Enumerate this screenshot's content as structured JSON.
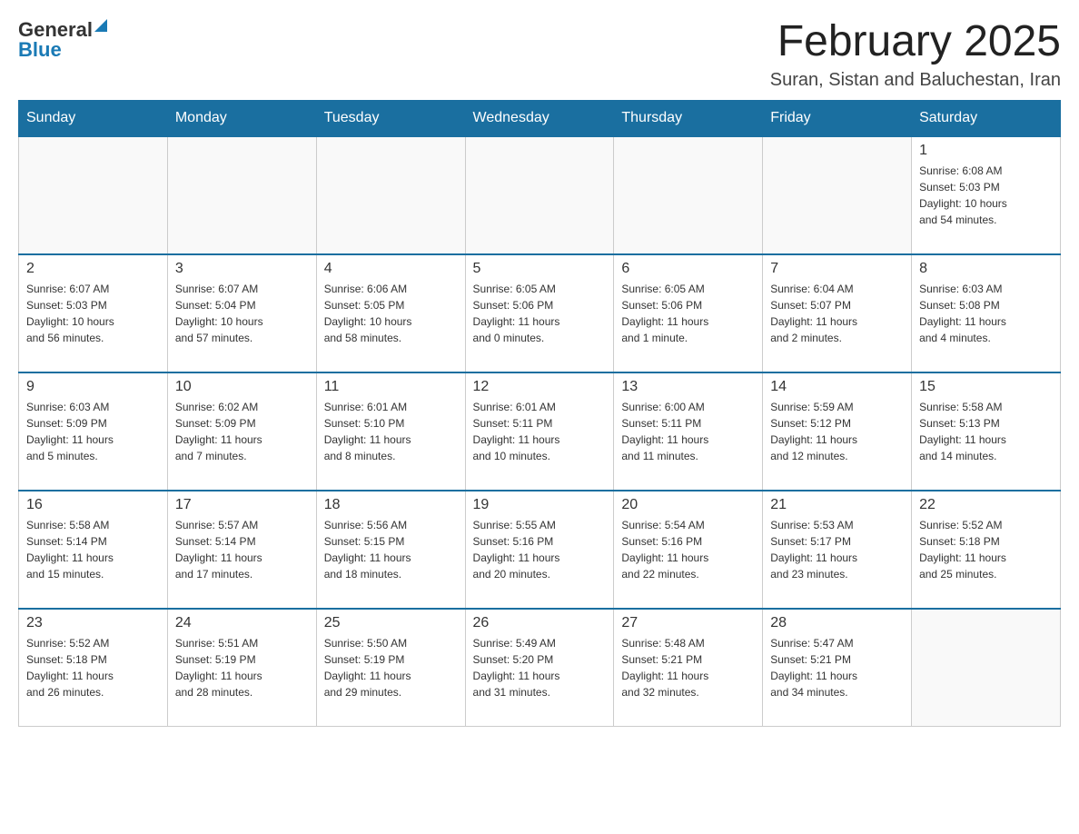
{
  "logo": {
    "general": "General",
    "blue": "Blue",
    "triangle": "▶"
  },
  "header": {
    "month_year": "February 2025",
    "location": "Suran, Sistan and Baluchestan, Iran"
  },
  "days_of_week": [
    "Sunday",
    "Monday",
    "Tuesday",
    "Wednesday",
    "Thursday",
    "Friday",
    "Saturday"
  ],
  "weeks": [
    [
      {
        "day": "",
        "info": ""
      },
      {
        "day": "",
        "info": ""
      },
      {
        "day": "",
        "info": ""
      },
      {
        "day": "",
        "info": ""
      },
      {
        "day": "",
        "info": ""
      },
      {
        "day": "",
        "info": ""
      },
      {
        "day": "1",
        "info": "Sunrise: 6:08 AM\nSunset: 5:03 PM\nDaylight: 10 hours\nand 54 minutes."
      }
    ],
    [
      {
        "day": "2",
        "info": "Sunrise: 6:07 AM\nSunset: 5:03 PM\nDaylight: 10 hours\nand 56 minutes."
      },
      {
        "day": "3",
        "info": "Sunrise: 6:07 AM\nSunset: 5:04 PM\nDaylight: 10 hours\nand 57 minutes."
      },
      {
        "day": "4",
        "info": "Sunrise: 6:06 AM\nSunset: 5:05 PM\nDaylight: 10 hours\nand 58 minutes."
      },
      {
        "day": "5",
        "info": "Sunrise: 6:05 AM\nSunset: 5:06 PM\nDaylight: 11 hours\nand 0 minutes."
      },
      {
        "day": "6",
        "info": "Sunrise: 6:05 AM\nSunset: 5:06 PM\nDaylight: 11 hours\nand 1 minute."
      },
      {
        "day": "7",
        "info": "Sunrise: 6:04 AM\nSunset: 5:07 PM\nDaylight: 11 hours\nand 2 minutes."
      },
      {
        "day": "8",
        "info": "Sunrise: 6:03 AM\nSunset: 5:08 PM\nDaylight: 11 hours\nand 4 minutes."
      }
    ],
    [
      {
        "day": "9",
        "info": "Sunrise: 6:03 AM\nSunset: 5:09 PM\nDaylight: 11 hours\nand 5 minutes."
      },
      {
        "day": "10",
        "info": "Sunrise: 6:02 AM\nSunset: 5:09 PM\nDaylight: 11 hours\nand 7 minutes."
      },
      {
        "day": "11",
        "info": "Sunrise: 6:01 AM\nSunset: 5:10 PM\nDaylight: 11 hours\nand 8 minutes."
      },
      {
        "day": "12",
        "info": "Sunrise: 6:01 AM\nSunset: 5:11 PM\nDaylight: 11 hours\nand 10 minutes."
      },
      {
        "day": "13",
        "info": "Sunrise: 6:00 AM\nSunset: 5:11 PM\nDaylight: 11 hours\nand 11 minutes."
      },
      {
        "day": "14",
        "info": "Sunrise: 5:59 AM\nSunset: 5:12 PM\nDaylight: 11 hours\nand 12 minutes."
      },
      {
        "day": "15",
        "info": "Sunrise: 5:58 AM\nSunset: 5:13 PM\nDaylight: 11 hours\nand 14 minutes."
      }
    ],
    [
      {
        "day": "16",
        "info": "Sunrise: 5:58 AM\nSunset: 5:14 PM\nDaylight: 11 hours\nand 15 minutes."
      },
      {
        "day": "17",
        "info": "Sunrise: 5:57 AM\nSunset: 5:14 PM\nDaylight: 11 hours\nand 17 minutes."
      },
      {
        "day": "18",
        "info": "Sunrise: 5:56 AM\nSunset: 5:15 PM\nDaylight: 11 hours\nand 18 minutes."
      },
      {
        "day": "19",
        "info": "Sunrise: 5:55 AM\nSunset: 5:16 PM\nDaylight: 11 hours\nand 20 minutes."
      },
      {
        "day": "20",
        "info": "Sunrise: 5:54 AM\nSunset: 5:16 PM\nDaylight: 11 hours\nand 22 minutes."
      },
      {
        "day": "21",
        "info": "Sunrise: 5:53 AM\nSunset: 5:17 PM\nDaylight: 11 hours\nand 23 minutes."
      },
      {
        "day": "22",
        "info": "Sunrise: 5:52 AM\nSunset: 5:18 PM\nDaylight: 11 hours\nand 25 minutes."
      }
    ],
    [
      {
        "day": "23",
        "info": "Sunrise: 5:52 AM\nSunset: 5:18 PM\nDaylight: 11 hours\nand 26 minutes."
      },
      {
        "day": "24",
        "info": "Sunrise: 5:51 AM\nSunset: 5:19 PM\nDaylight: 11 hours\nand 28 minutes."
      },
      {
        "day": "25",
        "info": "Sunrise: 5:50 AM\nSunset: 5:19 PM\nDaylight: 11 hours\nand 29 minutes."
      },
      {
        "day": "26",
        "info": "Sunrise: 5:49 AM\nSunset: 5:20 PM\nDaylight: 11 hours\nand 31 minutes."
      },
      {
        "day": "27",
        "info": "Sunrise: 5:48 AM\nSunset: 5:21 PM\nDaylight: 11 hours\nand 32 minutes."
      },
      {
        "day": "28",
        "info": "Sunrise: 5:47 AM\nSunset: 5:21 PM\nDaylight: 11 hours\nand 34 minutes."
      },
      {
        "day": "",
        "info": ""
      }
    ]
  ]
}
